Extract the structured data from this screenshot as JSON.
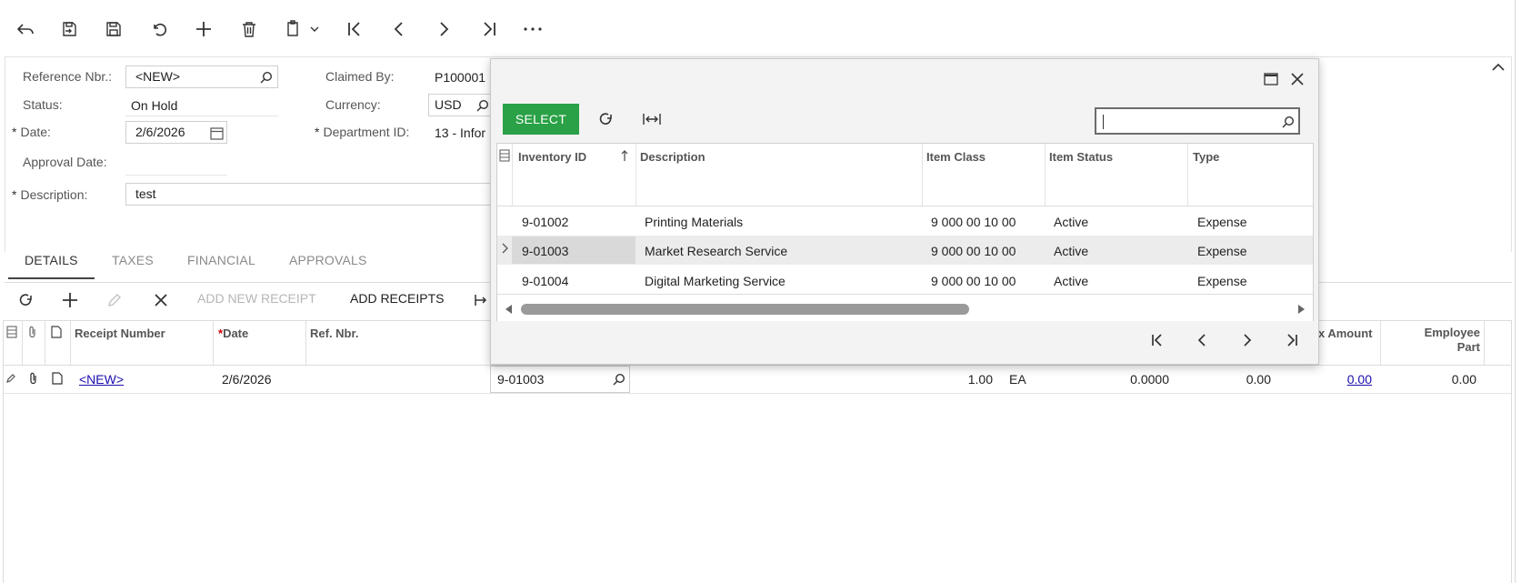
{
  "toolbar": {
    "icons": [
      "undo-back-icon",
      "save-close-icon",
      "save-icon",
      "cancel-icon",
      "add-icon",
      "delete-icon",
      "copy-paste-icon",
      "first-record-icon",
      "previous-record-icon",
      "next-record-icon",
      "last-record-icon",
      "more-icon"
    ]
  },
  "form": {
    "ref_nbr_label": "Reference Nbr.:",
    "ref_nbr_value": "<NEW>",
    "status_label": "Status:",
    "status_value": "On Hold",
    "date_label": "Date:",
    "date_value": "2/6/2026",
    "approval_date_label": "Approval Date:",
    "description_label": "Description:",
    "description_value": "test",
    "claimed_by_label": "Claimed By:",
    "claimed_by_value": "P100001",
    "currency_label": "Currency:",
    "currency_value": "USD",
    "department_label": "Department ID:",
    "department_value": "13 - Infor",
    "required_mark": "*"
  },
  "tabs": [
    {
      "label": "DETAILS",
      "active": true
    },
    {
      "label": "TAXES",
      "active": false
    },
    {
      "label": "FINANCIAL",
      "active": false
    },
    {
      "label": "APPROVALS",
      "active": false
    }
  ],
  "grid_toolbar": {
    "add_new_receipt": "ADD NEW RECEIPT",
    "add_receipts": "ADD RECEIPTS"
  },
  "grid": {
    "headers": {
      "receipt_number": "Receipt Number",
      "date": "Date",
      "ref_nbr": "Ref. Nbr.",
      "tax_amount": "x Amount",
      "employee_part_1": "Employee",
      "employee_part_2": "Part"
    },
    "row": {
      "receipt_number": "<NEW>",
      "date": "2/6/2026",
      "inventory_id": "9-01003",
      "quantity": "1.00",
      "uom": "EA",
      "unit_cost": "0.0000",
      "amount": "0.00",
      "tax_amount": "0.00",
      "employee_part": "0.00"
    }
  },
  "dialog": {
    "select_label": "SELECT",
    "search_value": "",
    "columns": {
      "inventory_id": "Inventory ID",
      "description": "Description",
      "item_class": "Item Class",
      "item_status": "Item Status",
      "type": "Type"
    },
    "rows": [
      {
        "inventory_id": "9-01002",
        "description": "Printing Materials",
        "item_class": "9 000 00 10 00",
        "item_status": "Active",
        "type": "Expense"
      },
      {
        "inventory_id": "9-01003",
        "description": "Market Research Service",
        "item_class": "9 000 00 10 00",
        "item_status": "Active",
        "type": "Expense"
      },
      {
        "inventory_id": "9-01004",
        "description": "Digital Marketing Service",
        "item_class": "9 000 00 10 00",
        "item_status": "Active",
        "type": "Expense"
      }
    ],
    "selected_row": 1
  },
  "colors": {
    "select_button": "#2aa146",
    "link": "#1a0dab",
    "required": "#cc0000"
  }
}
